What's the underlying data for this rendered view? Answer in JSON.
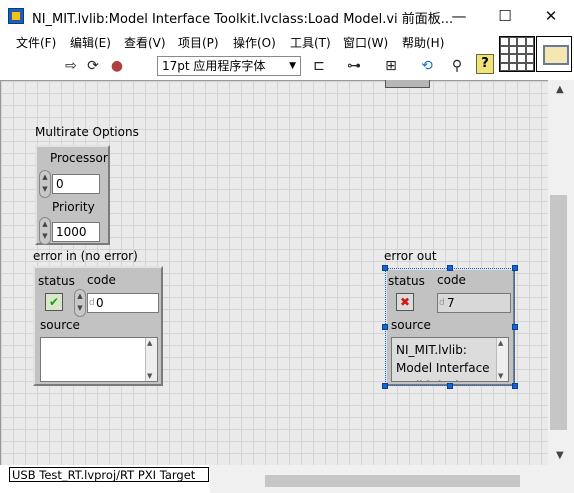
{
  "window": {
    "title": "NI_MIT.lvlib:Model Interface Toolkit.lvclass:Load Model.vi 前面板...",
    "minimize_label": "—",
    "maximize_label": "☐",
    "close_label": "✕"
  },
  "menu": {
    "items": [
      {
        "label": "文件(F)"
      },
      {
        "label": "编辑(E)"
      },
      {
        "label": "查看(V)"
      },
      {
        "label": "项目(P)"
      },
      {
        "label": "操作(O)"
      },
      {
        "label": "工具(T)"
      },
      {
        "label": "窗口(W)"
      },
      {
        "label": "帮助(H)"
      }
    ]
  },
  "toolbar": {
    "run_icon": "⇨",
    "run_continuous_icon": "⟳",
    "abort_icon": "●",
    "font_select_value": "17pt 应用程序字体",
    "align_icon": "⊏",
    "distribute_icon": "⊶",
    "resize_icon": "⊞",
    "reorder_icon": "⟲",
    "search_icon": "⚲",
    "help_label": "?"
  },
  "front_panel": {
    "multirate_options": {
      "label": "Multirate Options",
      "processor_label": "Processor",
      "processor_value": "0",
      "priority_label": "Priority",
      "priority_value": "1000"
    },
    "error_in": {
      "label": "error in (no error)",
      "status_label": "status",
      "status_glyph": "✔",
      "code_label": "code",
      "code_radix": "d",
      "code_value": "0",
      "source_label": "source",
      "source_value": ""
    },
    "error_out": {
      "label": "error out",
      "status_label": "status",
      "status_glyph": "✖",
      "code_label": "code",
      "code_radix": "d",
      "code_value": "7",
      "source_label": "source",
      "source_value": "NI_MIT.lvlib: Model Interface Toolkit.lvclass"
    }
  },
  "status_bar": {
    "target": "USB Test_RT.lvproj/RT PXI Target"
  },
  "colors": {
    "cluster_fill": "#c2c2c2",
    "status_ok_green": "#1c9a1c",
    "status_error_red": "#d01818",
    "selection_blue": "#1565d8"
  }
}
